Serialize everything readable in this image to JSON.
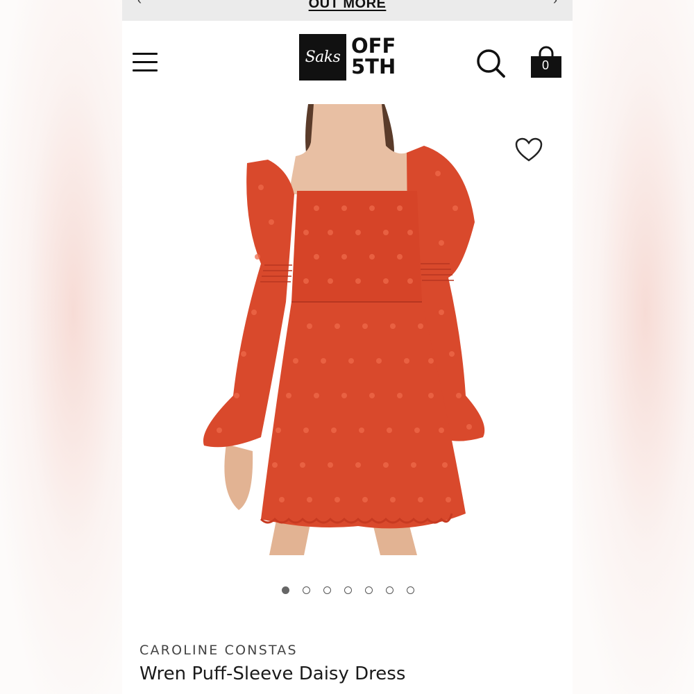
{
  "promo": {
    "text": "OUT MORE"
  },
  "logo": {
    "script_text": "Saks",
    "brand_line1": "OFF",
    "brand_line2": "5TH"
  },
  "cart": {
    "count": "0"
  },
  "icons": {
    "menu": "hamburger-menu-icon",
    "search": "search-icon",
    "bag": "shopping-bag-icon",
    "wishlist": "heart-icon"
  },
  "carousel": {
    "total": 7,
    "active_index": 0
  },
  "product": {
    "brand": "CAROLINE CONSTAS",
    "name": "Wren Puff-Sleeve Daisy Dress",
    "image_alt": "Orange-red eyelet daisy mini dress with puff sleeves"
  },
  "colors": {
    "dress": "#d9492c",
    "accent": "#111111",
    "page_bg": "#ffffff"
  }
}
